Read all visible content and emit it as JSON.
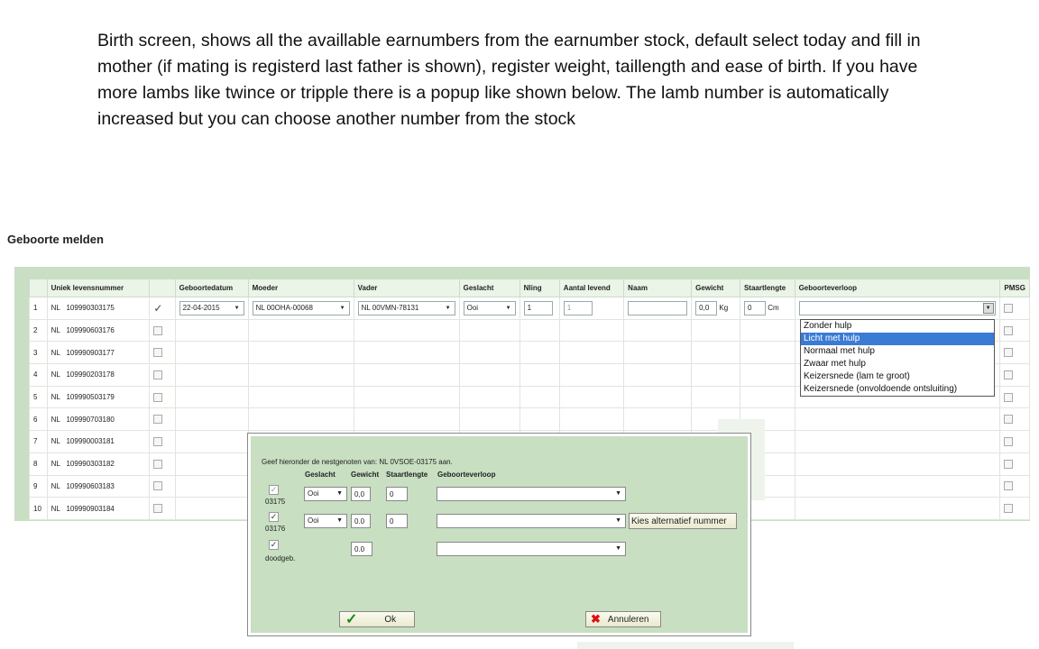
{
  "description": "Birth screen, shows all the availlable earnumbers from the earnumber stock, default select today and fill in mother (if mating is registerd last father is shown), register weight, taillength and ease of birth. If you have more lambs like twince or tripple there is a popup like shown below. The lamb number is automatically increased but you can choose another number from the stock",
  "screen": {
    "title": "Geboorte melden",
    "columns": [
      "",
      "Uniek levensnummer",
      "",
      "Geboortedatum",
      "Moeder",
      "Vader",
      "Geslacht",
      "Nling",
      "Aantal levend",
      "Naam",
      "Gewicht",
      "Staartlengte",
      "Geboorteverloop",
      "PMSG"
    ],
    "first_row": {
      "num": "1",
      "country": "NL",
      "earnumber": "109990303175",
      "date": "22-04-2015",
      "mother": "NL 00OHA-00068",
      "father": "NL 00VMN-78131",
      "gender": "Ooi",
      "nling": "1",
      "alive": "1",
      "name": "",
      "weight": "0,0",
      "weight_unit": "Kg",
      "tail": "0",
      "tail_unit": "Cm"
    },
    "rows": [
      {
        "num": "2",
        "country": "NL",
        "earnumber": "109990603176"
      },
      {
        "num": "3",
        "country": "NL",
        "earnumber": "109990903177"
      },
      {
        "num": "4",
        "country": "NL",
        "earnumber": "109990203178"
      },
      {
        "num": "5",
        "country": "NL",
        "earnumber": "109990503179"
      },
      {
        "num": "6",
        "country": "NL",
        "earnumber": "109990703180"
      },
      {
        "num": "7",
        "country": "NL",
        "earnumber": "109990003181"
      },
      {
        "num": "8",
        "country": "NL",
        "earnumber": "109990303182"
      },
      {
        "num": "9",
        "country": "NL",
        "earnumber": "109990603183"
      },
      {
        "num": "10",
        "country": "NL",
        "earnumber": "109990903184"
      }
    ],
    "birth_options": [
      "Zonder hulp",
      "Licht met hulp",
      "Normaal met hulp",
      "Zwaar met hulp",
      "Keizersnede (lam te groot)",
      "Keizersnede (onvoldoende ontsluiting)"
    ],
    "selected_option_index": 1
  },
  "popup": {
    "intro": "Geef hieronder de nestgenoten van: NL 0VSOE-03175 aan.",
    "headers": {
      "gender": "Geslacht",
      "weight": "Gewicht",
      "tail": "Staartlengte",
      "birth": "Geboorteverloop"
    },
    "lambs": [
      {
        "label": "03175",
        "gender": "Ooi",
        "weight": "0,0",
        "tail": "0"
      },
      {
        "label": "03176",
        "gender": "Ooi",
        "weight": "0.0",
        "tail": "0"
      },
      {
        "label": "doodgeb.",
        "weight": "0.0"
      }
    ],
    "alt_button": "Kies alternatief nummer",
    "ok_button": "Ok",
    "cancel_button": "Annuleren"
  },
  "colors": {
    "panel_green": "#c9dfc4",
    "highlight": "#3a7bd5"
  }
}
